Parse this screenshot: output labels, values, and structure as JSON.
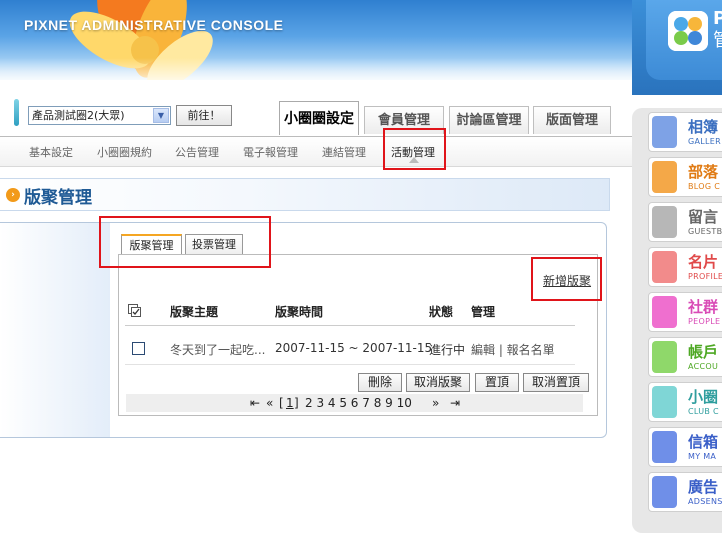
{
  "banner": {
    "title": "PIXNET ADMINISTRATIVE CONSOLE"
  },
  "toolbar": {
    "group_select_value": "產品測試圈2(大眾)",
    "go_label": "前往！"
  },
  "main_tabs": [
    {
      "label": "小圈圈設定",
      "active": true
    },
    {
      "label": "會員管理",
      "active": false
    },
    {
      "label": "討論區管理",
      "active": false
    },
    {
      "label": "版面管理",
      "active": false
    }
  ],
  "subnav": [
    {
      "label": "基本設定"
    },
    {
      "label": "小圈圈規約"
    },
    {
      "label": "公告管理"
    },
    {
      "label": "電子報管理"
    },
    {
      "label": "連結管理"
    },
    {
      "label": "活動管理",
      "active": true
    }
  ],
  "section": {
    "title": "版聚管理"
  },
  "inner_tabs": [
    {
      "label": "版聚管理",
      "active": true
    },
    {
      "label": "投票管理",
      "active": false
    }
  ],
  "list": {
    "add_link": "新增版聚",
    "columns": [
      "版聚主題",
      "版聚時間",
      "狀態",
      "管理"
    ],
    "rows": [
      {
        "title": "冬天到了一起吃...",
        "time": "2007-11-15 ~ 2007-11-15",
        "status": "進行中",
        "manage": "編輯 | 報名名單"
      }
    ],
    "buttons": [
      "刪除",
      "取消版聚",
      "置頂",
      "取消置頂"
    ],
    "pager": {
      "first": "⇤",
      "prev": "«",
      "open": "[",
      "current": "1",
      "close": "]",
      "pages": "2 3 4 5 6 7 8 9 10",
      "next": "»",
      "last": "⇥"
    }
  },
  "sidebar": {
    "logo_text_1": "P",
    "logo_text_2": "管",
    "items": [
      {
        "zh": "相簿",
        "en": "GALLER",
        "color": "#7ea2e6",
        "text_color": "#3b6fc0"
      },
      {
        "zh": "部落",
        "en": "BLOG C",
        "color": "#f4a848",
        "text_color": "#e07b14"
      },
      {
        "zh": "留言",
        "en": "GUESTB",
        "color": "#b7b7b7",
        "text_color": "#666666"
      },
      {
        "zh": "名片",
        "en": "PROFILE",
        "color": "#f28b8b",
        "text_color": "#e04a4a"
      },
      {
        "zh": "社群",
        "en": "PEOPLE",
        "color": "#ef6fcf",
        "text_color": "#d94bb6"
      },
      {
        "zh": "帳戶",
        "en": "ACCOU",
        "color": "#8fd86a",
        "text_color": "#4ea824"
      },
      {
        "zh": "小圈",
        "en": "CLUB C",
        "color": "#7fd6d6",
        "text_color": "#2f9e9e"
      },
      {
        "zh": "信箱",
        "en": "MY MA",
        "color": "#6f8fe8",
        "text_color": "#3a5fc8"
      },
      {
        "zh": "廣告",
        "en": "ADSENS",
        "color": "#6f8fe8",
        "text_color": "#3a5fc8"
      }
    ]
  }
}
